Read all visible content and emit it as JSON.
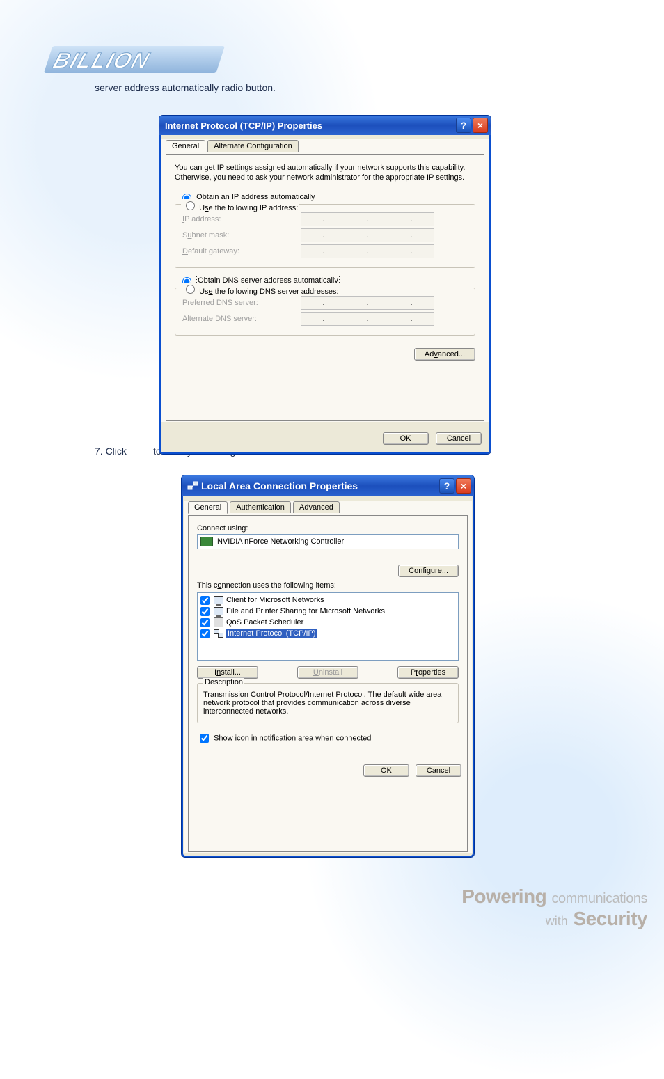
{
  "logo_text": "BILLION",
  "caption_top": "server address automatically radio button.",
  "step7_prefix": "7. Click",
  "step7_suffix": "to save your changes.",
  "dlg1": {
    "title": "Internet Protocol (TCP/IP) Properties",
    "tabs": {
      "general": "General",
      "alt": "Alternate Configuration"
    },
    "desc": "You can get IP settings assigned automatically if your network supports this capability. Otherwise, you need to ask your network administrator for the appropriate IP settings.",
    "radio_obtain_ip": "Obtain an IP address automatically",
    "radio_use_ip": "Use the following IP address:",
    "ip_label": "IP address:",
    "subnet_label": "Subnet mask:",
    "gateway_label": "Default gateway:",
    "radio_obtain_dns": "Obtain DNS server address automatically",
    "radio_use_dns": "Use the following DNS server addresses:",
    "pref_dns_label": "Preferred DNS server:",
    "alt_dns_label": "Alternate DNS server:",
    "advanced_btn": "Advanced...",
    "ok_btn": "OK",
    "cancel_btn": "Cancel"
  },
  "dlg2": {
    "title": "Local Area Connection Properties",
    "tabs": {
      "general": "General",
      "auth": "Authentication",
      "adv": "Advanced"
    },
    "connect_using": "Connect using:",
    "adapter": "NVIDIA nForce Networking Controller",
    "configure_btn": "Configure...",
    "items_label": "This connection uses the following items:",
    "items": [
      "Client for Microsoft Networks",
      "File and Printer Sharing for Microsoft Networks",
      "QoS Packet Scheduler",
      "Internet Protocol (TCP/IP)"
    ],
    "install_btn": "Install...",
    "uninstall_btn": "Uninstall",
    "properties_btn": "Properties",
    "desc_legend": "Description",
    "desc_text": "Transmission Control Protocol/Internet Protocol. The default wide area network protocol that provides communication across diverse interconnected networks.",
    "show_icon": "Show icon in notification area when connected",
    "ok_btn": "OK",
    "cancel_btn": "Cancel"
  },
  "footer": {
    "line1a": "Powering",
    "line1b": "communications",
    "line2a": "with",
    "line2b": "Security"
  }
}
